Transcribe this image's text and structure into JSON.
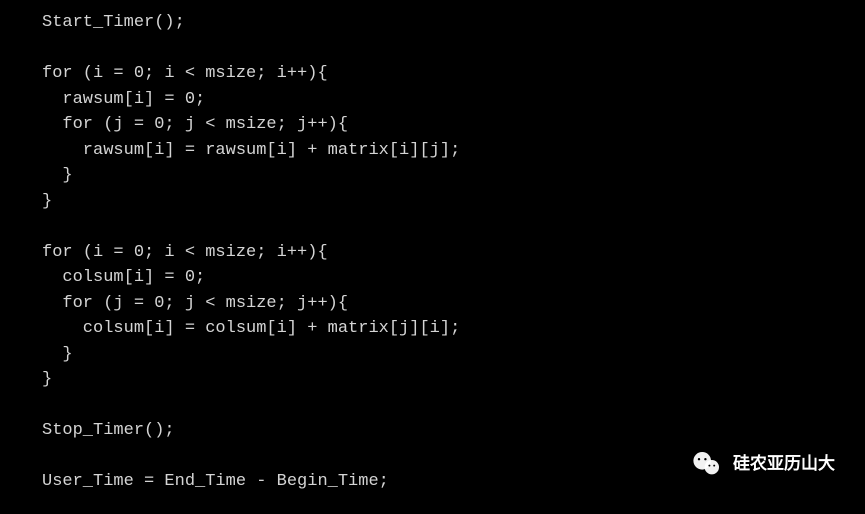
{
  "code": {
    "lines": [
      "Start_Timer();",
      "",
      "for (i = 0; i < msize; i++){",
      "  rawsum[i] = 0;",
      "  for (j = 0; j < msize; j++){",
      "    rawsum[i] = rawsum[i] + matrix[i][j];",
      "  }",
      "}",
      "",
      "for (i = 0; i < msize; i++){",
      "  colsum[i] = 0;",
      "  for (j = 0; j < msize; j++){",
      "    colsum[i] = colsum[i] + matrix[j][i];",
      "  }",
      "}",
      "",
      "Stop_Timer();",
      "",
      "User_Time = End_Time - Begin_Time;"
    ]
  },
  "watermark": {
    "text": "硅农亚历山大"
  }
}
